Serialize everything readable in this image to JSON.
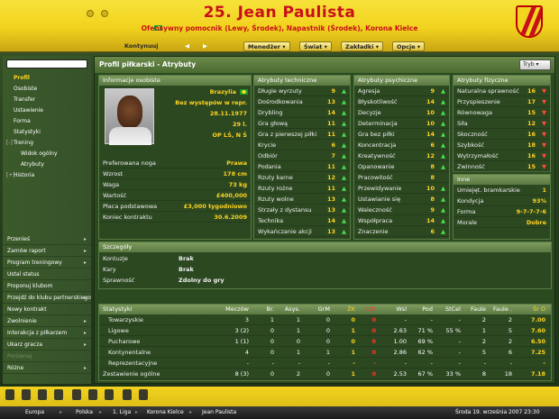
{
  "header": {
    "title": "25. Jean Paulista",
    "subtitle": "Ofensywny pomocnik (Lewy, Środek), Napastnik (Środek), Korona Kielce"
  },
  "nav": {
    "continue": "Kontynuuj",
    "manager": "Menedżer",
    "world": "Świat",
    "bookmarks": "Zakładki",
    "options": "Opcje"
  },
  "sidebar": {
    "menu": [
      "Profil",
      "Osobiste",
      "Transfer",
      "Ustawienie",
      "Forma",
      "Statystyki",
      "Trening",
      "Widok ogólny",
      "Atrybuty",
      "Historia"
    ],
    "actions": [
      "Przenieś",
      "Zamów raport",
      "Program treningowy",
      "Ustal status",
      "Proponuj klubom",
      "Przejdź do klubu partnerskiego",
      "Nowy kontrakt",
      "Zwolnienie",
      "Interakcja z piłkarzem",
      "Ukarz gracza",
      "Porównaj",
      "Różne"
    ]
  },
  "main": {
    "title": "Profil piłkarski - Atrybuty",
    "mode": "Tryb"
  },
  "personal": {
    "title": "Informacje osobiste",
    "nationality": "Brazylia",
    "intl": "Bez występów w repr.",
    "dob": "28.11.1977",
    "age": "29 l.",
    "position": "OP LŚ, N Ś",
    "rows": [
      {
        "label": "Preferowana noga",
        "value": "Prawa"
      },
      {
        "label": "Wzrost",
        "value": "178 cm"
      },
      {
        "label": "Waga",
        "value": "73 kg"
      },
      {
        "label": "Wartość",
        "value": "£400,000"
      },
      {
        "label": "Płaca podstawowa",
        "value": "£3,000 tygodniowo"
      },
      {
        "label": "Koniec kontraktu",
        "value": "30.6.2009"
      }
    ]
  },
  "technical": {
    "title": "Atrybuty techniczne",
    "rows": [
      {
        "label": "Długie wyrzuty",
        "value": "9",
        "trend": "up"
      },
      {
        "label": "Dośrodkowania",
        "value": "13",
        "trend": "up"
      },
      {
        "label": "Drybling",
        "value": "14",
        "trend": "up"
      },
      {
        "label": "Gra głową",
        "value": "11",
        "trend": "up"
      },
      {
        "label": "Gra z pierwszej piłki",
        "value": "11",
        "trend": "up"
      },
      {
        "label": "Krycie",
        "value": "6",
        "trend": "up"
      },
      {
        "label": "Odbiór",
        "value": "7",
        "trend": "up"
      },
      {
        "label": "Podania",
        "value": "11",
        "trend": "up"
      },
      {
        "label": "Rzuty karne",
        "value": "12",
        "trend": "up"
      },
      {
        "label": "Rzuty rożne",
        "value": "11",
        "trend": "up"
      },
      {
        "label": "Rzuty wolne",
        "value": "13",
        "trend": "up"
      },
      {
        "label": "Strzały z dystansu",
        "value": "13",
        "trend": "up"
      },
      {
        "label": "Technika",
        "value": "14",
        "trend": "up"
      },
      {
        "label": "Wykańczanie akcji",
        "value": "13",
        "trend": "up"
      }
    ]
  },
  "mental": {
    "title": "Atrybuty psychiczne",
    "rows": [
      {
        "label": "Agresja",
        "value": "9",
        "trend": "up"
      },
      {
        "label": "Błyskotliwość",
        "value": "14",
        "trend": "up"
      },
      {
        "label": "Decyzje",
        "value": "10",
        "trend": "up"
      },
      {
        "label": "Determinacja",
        "value": "10",
        "trend": "up"
      },
      {
        "label": "Gra bez piłki",
        "value": "14",
        "trend": "up"
      },
      {
        "label": "Koncentracja",
        "value": "6",
        "trend": "up"
      },
      {
        "label": "Kreatywność",
        "value": "12",
        "trend": "up"
      },
      {
        "label": "Opanowanie",
        "value": "8",
        "trend": "up"
      },
      {
        "label": "Pracowitość",
        "value": "8",
        "trend": ""
      },
      {
        "label": "Przewidywanie",
        "value": "10",
        "trend": "up"
      },
      {
        "label": "Ustawianie się",
        "value": "8",
        "trend": "up"
      },
      {
        "label": "Waleczność",
        "value": "9",
        "trend": "up"
      },
      {
        "label": "Współpraca",
        "value": "14",
        "trend": "up"
      },
      {
        "label": "Znaczenie",
        "value": "6",
        "trend": "up"
      }
    ]
  },
  "physical": {
    "title": "Atrybuty fizyczne",
    "rows": [
      {
        "label": "Naturalna sprawność",
        "value": "16",
        "trend": "dn"
      },
      {
        "label": "Przyspieszenie",
        "value": "17",
        "trend": "dn"
      },
      {
        "label": "Równowaga",
        "value": "15",
        "trend": "dn"
      },
      {
        "label": "Siła",
        "value": "12",
        "trend": "dn"
      },
      {
        "label": "Skoczność",
        "value": "16",
        "trend": "dn"
      },
      {
        "label": "Szybkość",
        "value": "18",
        "trend": "dn"
      },
      {
        "label": "Wytrzymałość",
        "value": "16",
        "trend": "dn"
      },
      {
        "label": "Zwinność",
        "value": "15",
        "trend": "dn"
      }
    ]
  },
  "other": {
    "title": "Inne",
    "rows": [
      {
        "label": "Umiejęt. bramkarskie",
        "value": "1"
      },
      {
        "label": "Kondycja",
        "value": "93%"
      },
      {
        "label": "Forma",
        "value": "9-7-7-7-6"
      },
      {
        "label": "Morale",
        "value": "Dobre"
      }
    ]
  },
  "details": {
    "title": "Szczegóły",
    "rows": [
      {
        "label": "Kontuzje",
        "value": "Brak"
      },
      {
        "label": "Kary",
        "value": "Brak"
      },
      {
        "label": "Sprawność",
        "value": "Zdolny do gry"
      }
    ]
  },
  "stats": {
    "headers": [
      "Statystyki",
      "Meczów",
      "Br.",
      "Asys.",
      "GrM",
      "ŻK",
      "CzK",
      "Wsl",
      "Pod",
      "StCel",
      "Faule",
      "Faule .",
      "Śr O"
    ],
    "rows": [
      [
        "Towarzyskie",
        "3",
        "1",
        "1",
        "0",
        "0",
        "0",
        "-",
        "-",
        "-",
        "2",
        "2",
        "7.00"
      ],
      [
        "Ligowe",
        "3 (2)",
        "0",
        "1",
        "0",
        "1",
        "0",
        "2.63",
        "71 %",
        "55 %",
        "1",
        "5",
        "7.60"
      ],
      [
        "Pucharowe",
        "1 (1)",
        "0",
        "0",
        "0",
        "0",
        "0",
        "1.00",
        "69 %",
        "-",
        "2",
        "2",
        "6.50"
      ],
      [
        "Kontynentalne",
        "4",
        "0",
        "1",
        "1",
        "1",
        "0",
        "2.86",
        "62 %",
        "-",
        "5",
        "6",
        "7.25"
      ],
      [
        "Reprezentacyjne",
        "-",
        "-",
        "-",
        "-",
        "-",
        "-",
        "-",
        "-",
        "-",
        "-",
        "-",
        "-"
      ],
      [
        "Zestawienie ogólne",
        "8 (3)",
        "0",
        "2",
        "0",
        "1",
        "0",
        "2.53",
        "67 %",
        "33 %",
        "8",
        "18",
        "7.18"
      ]
    ]
  },
  "status_bar": {
    "crumbs": [
      "Europa",
      "Polska",
      "1. Liga",
      "Korona Kielce",
      "Jean Paulista"
    ],
    "datetime": "Środa 19. września 2007 23:30"
  },
  "colors": {
    "accent": "#ffd420",
    "header_red": "#c8101a",
    "up": "#48e04e",
    "down": "#ff4a3a"
  }
}
